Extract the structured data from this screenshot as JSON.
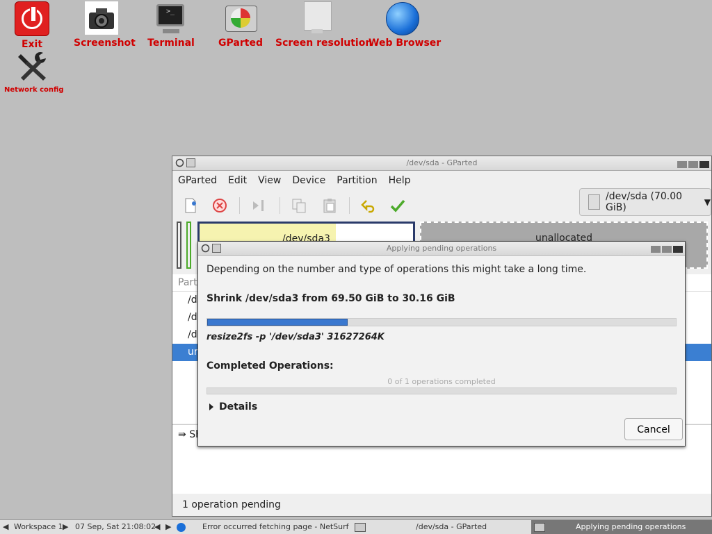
{
  "desktop": {
    "icons": [
      {
        "label": "Exit",
        "icon": "power-icon"
      },
      {
        "label": "Screenshot",
        "icon": "camera-icon"
      },
      {
        "label": "Terminal",
        "icon": "terminal-icon"
      },
      {
        "label": "GParted",
        "icon": "gparted-icon"
      },
      {
        "label": "Screen resolution",
        "icon": "monitor-icon"
      },
      {
        "label": "Web Browser",
        "icon": "globe-icon"
      },
      {
        "label": "Network config",
        "icon": "tools-icon"
      }
    ]
  },
  "gparted": {
    "title": "/dev/sda - GParted",
    "menu": [
      "GParted",
      "Edit",
      "View",
      "Device",
      "Partition",
      "Help"
    ],
    "device_selector": "/dev/sda (70.00 GiB)",
    "partitions_visual": {
      "sda3_label": "/dev/sda3",
      "sda3_used_fraction": 0.64,
      "unallocated_label": "unallocated"
    },
    "table": {
      "header": "Part",
      "rows": [
        "/d",
        "/d",
        "/d",
        "ur"
      ]
    },
    "pending_item": "Sh",
    "status": "1 operation pending"
  },
  "dialog": {
    "title": "Applying pending operations",
    "intro": "Depending on the number and type of operations this might take a long time.",
    "operation": "Shrink /dev/sda3 from 69.50 GiB to 30.16 GiB",
    "progress_fraction": 0.3,
    "command": "resize2fs -p '/dev/sda3' 31627264K",
    "completed_label": "Completed Operations:",
    "completed_count": "0 of 1 operations completed",
    "details_label": "Details",
    "cancel_label": "Cancel"
  },
  "taskbar": {
    "workspace": "Workspace 1",
    "clock": "07 Sep, Sat 21:08:02",
    "tasks": [
      {
        "label": "Error occurred fetching page - NetSurf",
        "active": false
      },
      {
        "label": "/dev/sda - GParted",
        "active": false
      },
      {
        "label": "Applying pending operations",
        "active": true
      }
    ]
  },
  "colors": {
    "desktop_bg": "#bebebe",
    "icon_label": "#d00000",
    "selection": "#3b7fd2",
    "progress": "#3a78cf"
  }
}
